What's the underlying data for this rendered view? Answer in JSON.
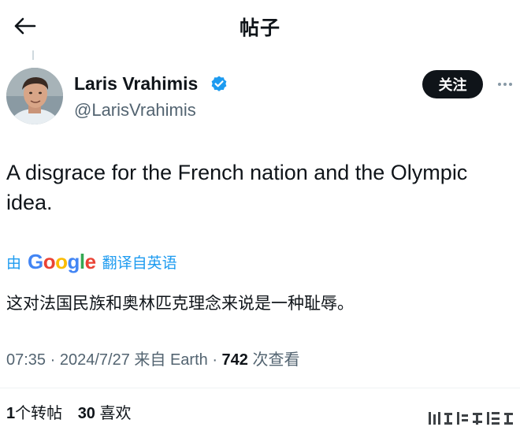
{
  "header": {
    "title": "帖子",
    "back_icon": "arrow-left-icon"
  },
  "author": {
    "display_name": "Laris Vrahimis",
    "handle": "@LarisVrahimis",
    "verified": true,
    "verified_color": "#1d9bf0"
  },
  "actions": {
    "follow_label": "关注",
    "more_icon": "more-horizontal-icon"
  },
  "tweet": {
    "text": "A disgrace for the French nation and the Olympic idea."
  },
  "translation": {
    "by_label": "由",
    "provider": "Google",
    "source_label": "翻译自英语",
    "translated_text": "这对法国民族和奥林匹克理念来说是一种耻辱。"
  },
  "meta": {
    "time": "07:35",
    "date": "2024/7/27",
    "source_prefix": "来自",
    "source": "Earth",
    "views_count": "742",
    "views_label": "次查看"
  },
  "stats": {
    "reposts_count": "1",
    "reposts_label": "个转帖",
    "likes_count": "30",
    "likes_label": "喜欢"
  },
  "colors": {
    "accent": "#1d9bf0",
    "text": "#0f1419",
    "secondary": "#536471"
  }
}
